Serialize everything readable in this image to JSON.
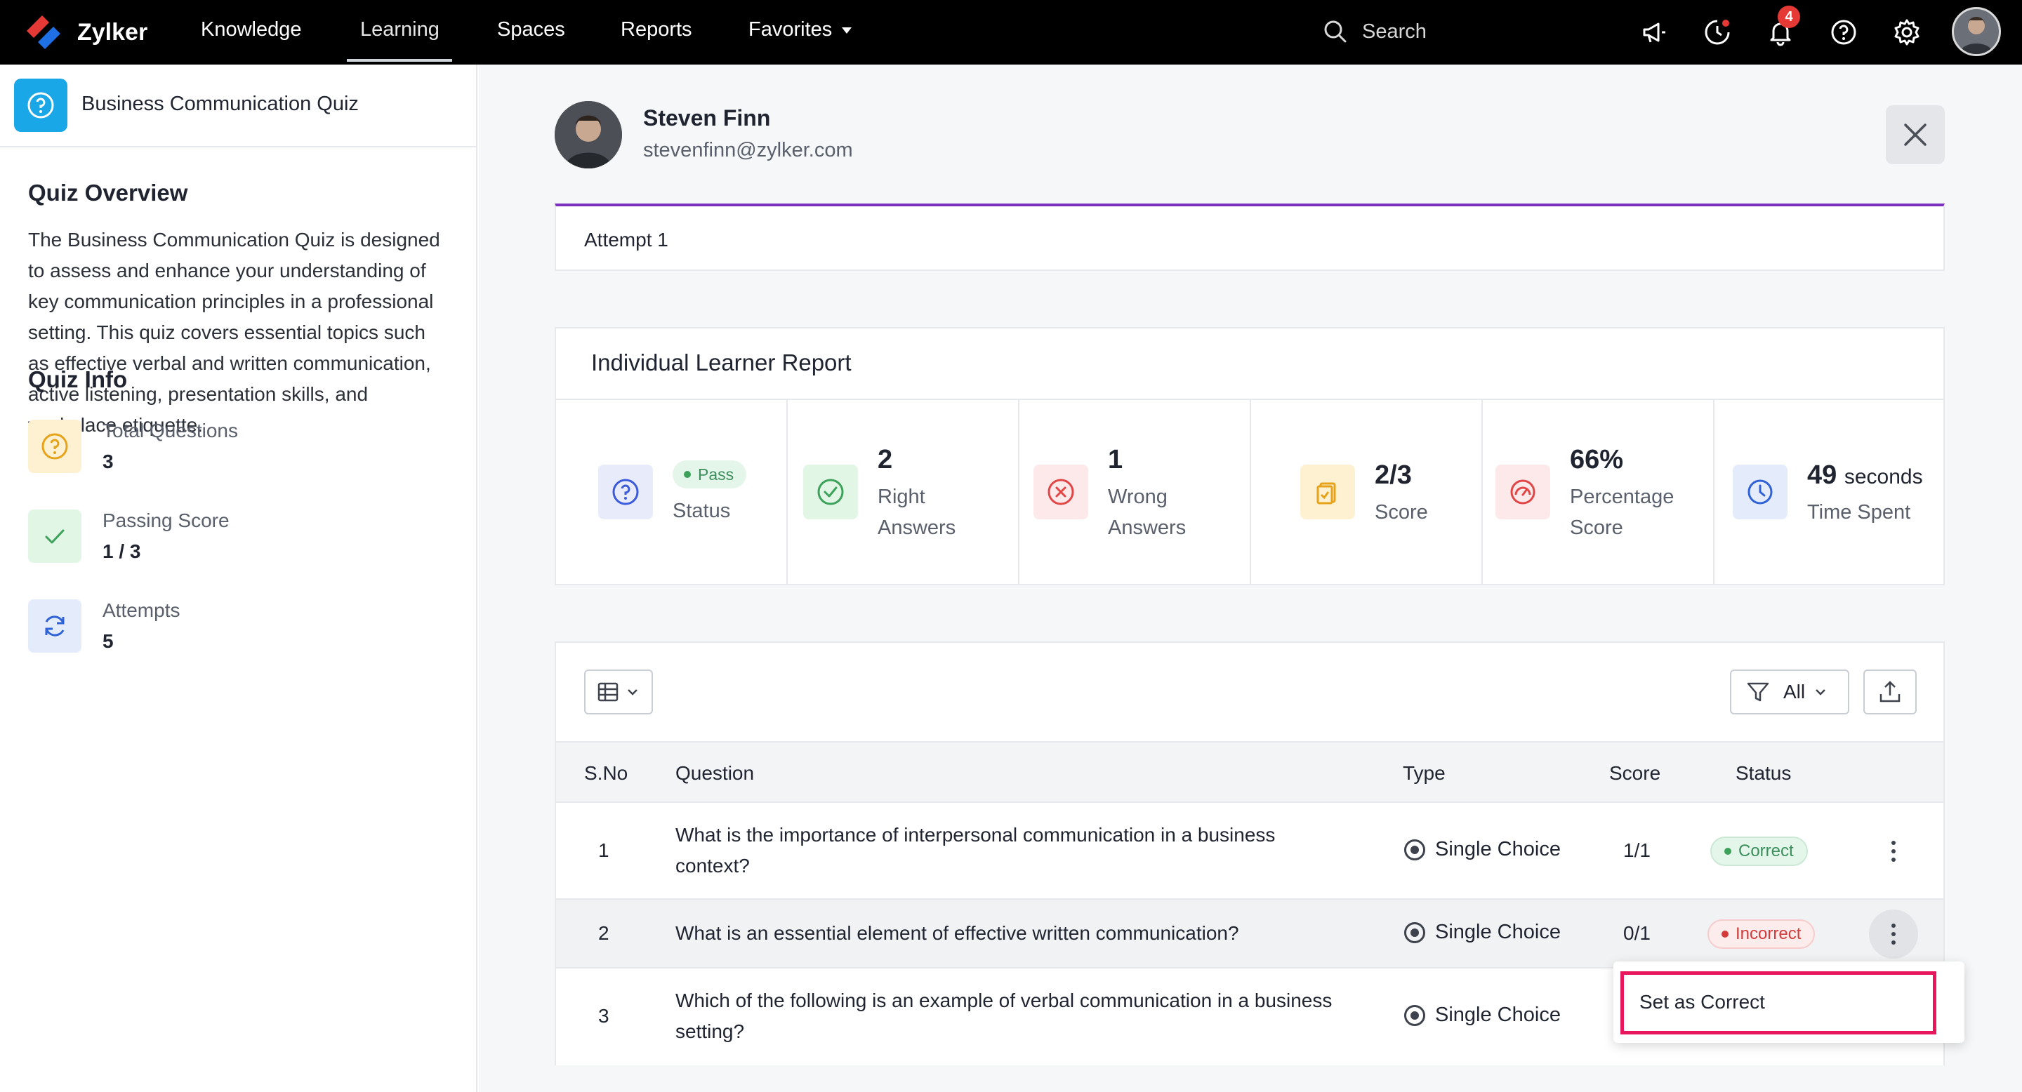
{
  "app": {
    "name": "Zylker"
  },
  "nav": {
    "items": [
      {
        "label": "Knowledge"
      },
      {
        "label": "Learning"
      },
      {
        "label": "Spaces"
      },
      {
        "label": "Reports"
      },
      {
        "label": "Favorites"
      }
    ],
    "search_label": "Search",
    "notification_count": "4"
  },
  "sidebar": {
    "quiz_title": "Business Communication Quiz",
    "overview_heading": "Quiz Overview",
    "overview_text": "The Business Communication Quiz is designed to assess and enhance your understanding of key communication principles in a professional setting. This quiz covers essential topics such as effective verbal and written communication, active listening, presentation skills, and workplace etiquette.",
    "info_heading": "Quiz Info",
    "info": [
      {
        "label": "Total Questions",
        "value": "3",
        "icon": "question-icon",
        "color": "#fdf1d2"
      },
      {
        "label": "Passing Score",
        "value": "1 / 3",
        "icon": "check-icon",
        "color": "#e2f6e6"
      },
      {
        "label": "Attempts",
        "value": "5",
        "icon": "refresh-icon",
        "color": "#e4ebfb"
      }
    ]
  },
  "learner": {
    "name": "Steven Finn",
    "email": "stevenfinn@zylker.com"
  },
  "attempt": {
    "label": "Attempt 1"
  },
  "report": {
    "title": "Individual Learner Report",
    "stats": [
      {
        "pill": "Pass",
        "label": "Status",
        "icon": "question-circle-icon"
      },
      {
        "value": "2",
        "label_1": "Right",
        "label_2": "Answers",
        "icon": "check-circle-icon"
      },
      {
        "value": "1",
        "label_1": "Wrong",
        "label_2": "Answers",
        "icon": "x-circle-icon"
      },
      {
        "value": "2/3",
        "label": "Score",
        "icon": "clipboard-icon"
      },
      {
        "value": "66%",
        "label_1": "Percentage",
        "label_2": "Score",
        "icon": "gauge-icon"
      },
      {
        "value": "49",
        "unit": "seconds",
        "label": "Time Spent",
        "icon": "clock-icon"
      }
    ]
  },
  "table": {
    "filter_label": "All",
    "columns": [
      "S.No",
      "Question",
      "Type",
      "Score",
      "Status"
    ],
    "rows": [
      {
        "sno": "1",
        "question_1": "What is the importance of interpersonal communication in a business",
        "question_2": "context?",
        "type": "Single Choice",
        "score": "1/1",
        "status": "Correct"
      },
      {
        "sno": "2",
        "question_1": "What is an essential element of effective written communication?",
        "question_2": "",
        "type": "Single Choice",
        "score": "0/1",
        "status": "Incorrect"
      },
      {
        "sno": "3",
        "question_1": "Which of the following is an example of verbal communication in a business",
        "question_2": "setting?",
        "type": "Single Choice",
        "score": "",
        "status": ""
      }
    ]
  },
  "context_menu": {
    "item": "Set as Correct"
  },
  "colors": {
    "accent_purple": "#7b2fbe",
    "correct_green": "#3c8f5c",
    "incorrect_red": "#d33a3a",
    "highlight_pink": "#e8175d"
  }
}
